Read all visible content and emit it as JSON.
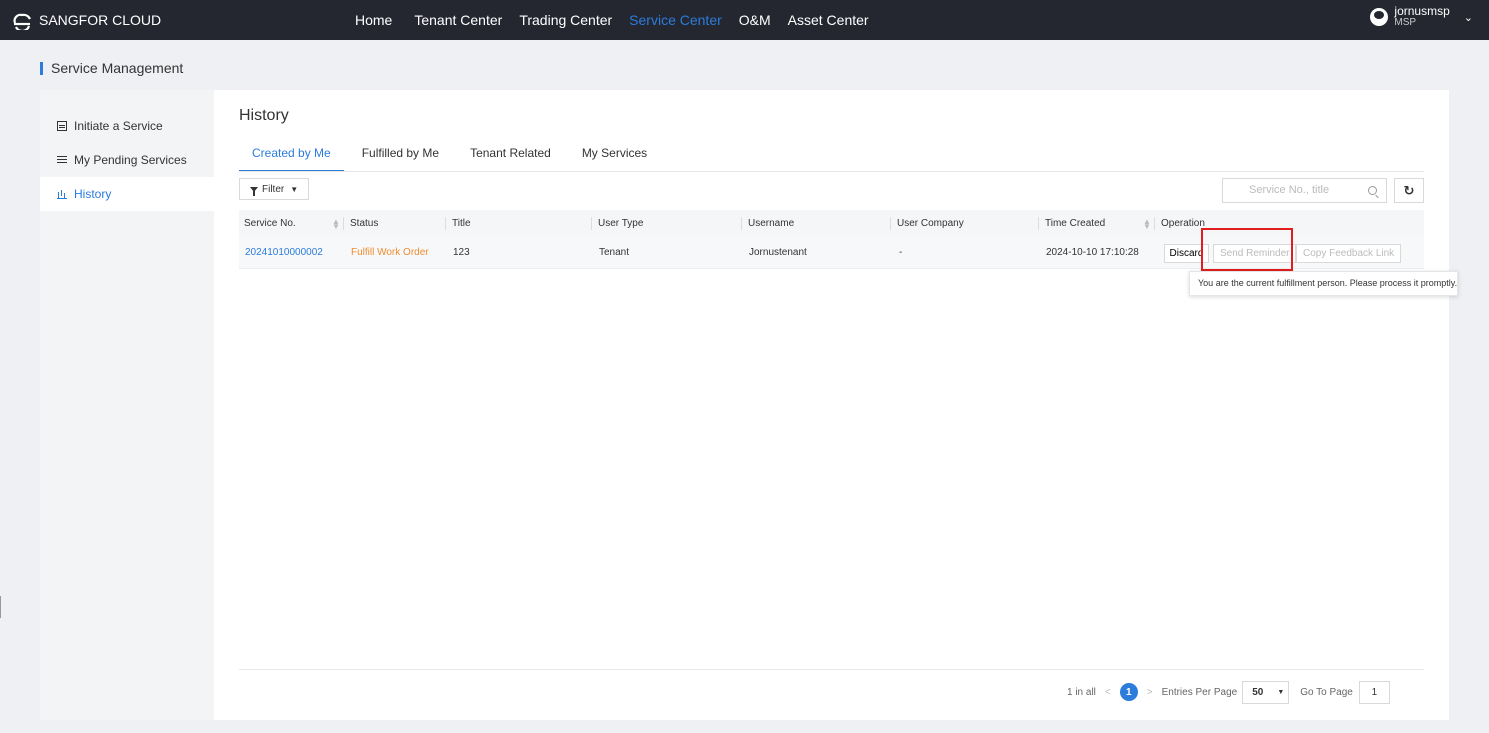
{
  "brand": {
    "name": "SANGFOR CLOUD"
  },
  "nav": [
    "Home",
    "Tenant Center",
    "Trading Center",
    "Service Center",
    "O&M",
    "Asset Center"
  ],
  "nav_active": "Service Center",
  "user": {
    "name": "jornusmsp",
    "role": "MSP"
  },
  "page_heading": "Service Management",
  "sidebar": {
    "items": [
      {
        "label": "Initiate a Service",
        "icon": "document-icon"
      },
      {
        "label": "My Pending Services",
        "icon": "list-icon"
      },
      {
        "label": "History",
        "icon": "bar-chart-icon"
      }
    ],
    "active": "History"
  },
  "main": {
    "title": "History",
    "tabs": [
      "Created by Me",
      "Fulfilled by Me",
      "Tenant Related",
      "My Services"
    ],
    "active_tab": "Created by Me",
    "filter_label": "Filter",
    "search_placeholder": "Service No., title",
    "refresh_icon": "refresh-icon"
  },
  "table": {
    "columns": [
      "Service No.",
      "Status",
      "Title",
      "User Type",
      "Username",
      "User Company",
      "Time Created",
      "Operation"
    ],
    "rows": [
      {
        "service_no": "20241010000002",
        "status": "Fulfill Work Order",
        "title": "123",
        "user_type": "Tenant",
        "username": "Jornustenant",
        "user_company": "-",
        "time_created": "2024-10-10 17:10:28",
        "operations": [
          "Discard",
          "Send Reminder",
          "Copy Feedback Link"
        ]
      }
    ]
  },
  "tooltip": "You are the current fulfillment person. Please process it promptly.",
  "pagination": {
    "total_text": "1 in all",
    "current_page": "1",
    "per_page_label": "Entries Per Page",
    "per_page_value": "50",
    "goto_label": "Go To Page",
    "goto_value": "1"
  },
  "colors": {
    "accent": "#2b7cdb",
    "topbar": "#24272f",
    "status_orange": "#f08c2e",
    "highlight": "#e21d1d"
  }
}
